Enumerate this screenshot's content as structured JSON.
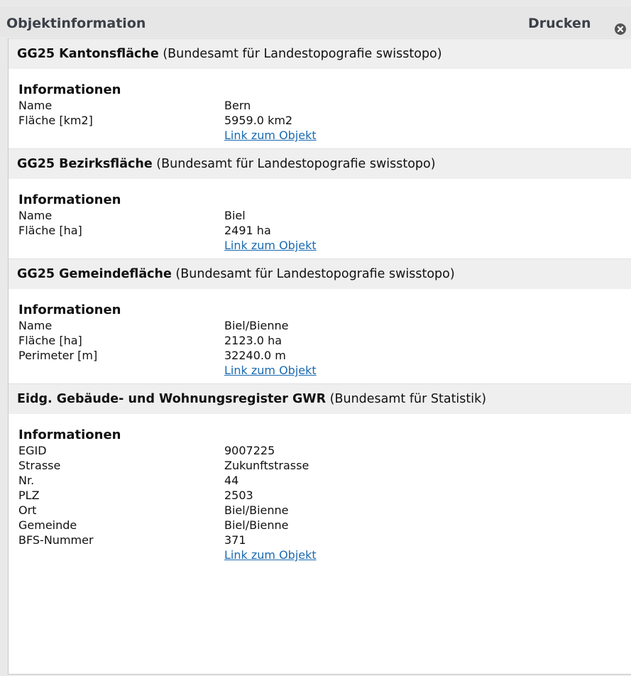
{
  "header": {
    "title": "Objektinformation",
    "print_label": "Drucken"
  },
  "sections": [
    {
      "title_bold": "GG25 Kantonsfläche",
      "title_source": " (Bundesamt für Landestopografie swisstopo)",
      "info_heading": "Informationen",
      "rows": [
        {
          "label": "Name",
          "value": "Bern"
        },
        {
          "label": "Fläche [km2]",
          "value": "5959.0 km2"
        }
      ],
      "link_label": "Link zum Objekt"
    },
    {
      "title_bold": "GG25 Bezirksfläche",
      "title_source": " (Bundesamt für Landestopografie swisstopo)",
      "info_heading": "Informationen",
      "rows": [
        {
          "label": "Name",
          "value": "Biel"
        },
        {
          "label": "Fläche [ha]",
          "value": "2491 ha"
        }
      ],
      "link_label": "Link zum Objekt"
    },
    {
      "title_bold": "GG25 Gemeindefläche",
      "title_source": " (Bundesamt für Landestopografie swisstopo)",
      "info_heading": "Informationen",
      "rows": [
        {
          "label": "Name",
          "value": "Biel/Bienne"
        },
        {
          "label": "Fläche [ha]",
          "value": "2123.0 ha"
        },
        {
          "label": "Perimeter [m]",
          "value": "32240.0 m"
        }
      ],
      "link_label": "Link zum Objekt"
    },
    {
      "title_bold": "Eidg. Gebäude- und Wohnungsregister GWR",
      "title_source": " (Bundesamt für Statistik)",
      "info_heading": "Informationen",
      "rows": [
        {
          "label": "EGID",
          "value": "9007225"
        },
        {
          "label": "Strasse",
          "value": "Zukunftstrasse"
        },
        {
          "label": "Nr.",
          "value": "44"
        },
        {
          "label": "PLZ",
          "value": "2503"
        },
        {
          "label": "Ort",
          "value": "Biel/Bienne"
        },
        {
          "label": "Gemeinde",
          "value": "Biel/Bienne"
        },
        {
          "label": "BFS-Nummer",
          "value": "371"
        }
      ],
      "link_label": "Link zum Objekt"
    }
  ]
}
